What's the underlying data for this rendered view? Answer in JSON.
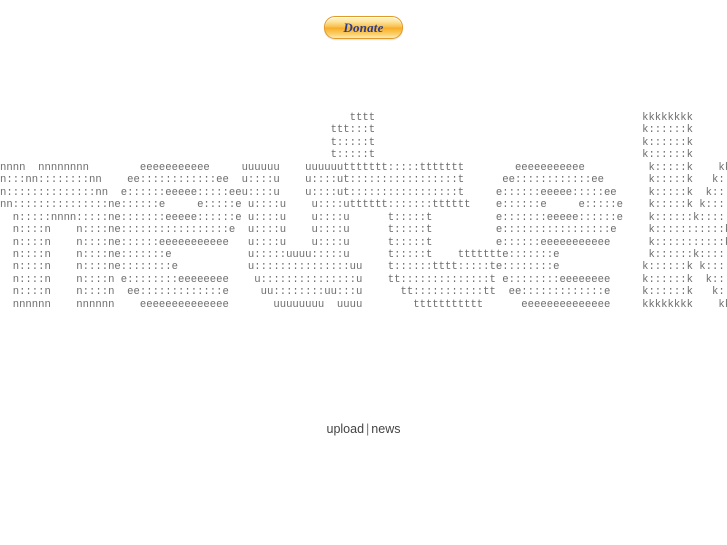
{
  "page": {
    "background_color": "#ffffff",
    "text_color": "#444444",
    "ascii_color": "#6e6e6e"
  },
  "donate": {
    "label": "Donate",
    "text_color": "#2a3c8f",
    "border_color": "#e09a2a",
    "gradient_top": "#fff4d2",
    "gradient_mid": "#f7ad25",
    "gradient_bottom": "#fde9b6"
  },
  "banner": {
    "word": "nneutek",
    "font_style": "figlet-ascii-art",
    "char_set": "nneutk:",
    "ascii": "                                                       tttt                                          kkkkkkkk\n                                                    ttt:::t                                          k::::::k\n                                                    t:::::t                                          k::::::k\n                                                    t:::::t                                          k::::::k\nnnnn  nnnnnnnn        eeeeeeeeeee     uuuuuu    uuuuuuttttttt:::::ttttttt        eeeeeeeeeee          k:::::k    kkkkkkk\nn:::nn::::::::nn    ee::::::::::::ee  u::::u    u::::ut:::::::::::::::::t      ee::::::::::::ee       k:::::k   k:::::k\nn::::::::::::::nn  e::::::eeeee:::::eeu::::u    u::::ut:::::::::::::::::t     e::::::eeeee:::::ee     k:::::k  k:::::k\nnn:::::::::::::::ne::::::e     e:::::e u::::u    u::::utttttt:::::::tttttt    e::::::e     e:::::e    k:::::k k:::::k\n  n:::::nnnn:::::ne:::::::eeeee::::::e u::::u    u::::u      t:::::t          e:::::::eeeee::::::e    k::::::k:::::k\n  n::::n    n::::ne:::::::::::::::::e  u::::u    u::::u      t:::::t          e:::::::::::::::::e     k:::::::::::k\n  n::::n    n::::ne::::::eeeeeeeeeee   u::::u    u::::u      t:::::t          e::::::eeeeeeeeeee      k:::::::::::k\n  n::::n    n::::ne:::::::e            u:::::uuuu:::::u      t:::::t    ttttttte:::::::e              k::::::k:::::k\n  n::::n    n::::ne::::::::e           u:::::::::::::::uu    t::::::tttt:::::te::::::::e             k::::::k k:::::k\n  n::::n    n::::n e::::::::eeeeeeee    u:::::::::::::::u    tt::::::::::::::t e::::::::eeeeeeee     k::::::k  k:::::k\n  n::::n    n::::n  ee:::::::::::::e     uu::::::::uu:::u      tt:::::::::::tt  ee:::::::::::::e     k::::::k   k:::::k\n  nnnnnn    nnnnnn    eeeeeeeeeeeeee       uuuuuuuu  uuuu        ttttttttttt      eeeeeeeeeeeeee     kkkkkkkk    kkkkkkk",
    "lines": [
      "                                                       tttt                                          kkkkkkkk",
      "                                                    ttt:::t                                          k::::::k",
      "                                                    t:::::t                                          k::::::k",
      "                                                    t:::::t                                          k::::::k",
      "nnnn  nnnnnnnn        eeeeeeeeeee     uuuuuu    uuuuuuttttttt:::::ttttttt        eeeeeeeeeee          k:::::k    kkkkkkk",
      "n:::nn::::::::nn    ee::::::::::::ee  u::::u    u::::ut:::::::::::::::::t      ee::::::::::::ee       k:::::k   k:::::k",
      "n::::::::::::::nn  e::::::eeeee:::::eeu::::u    u::::ut:::::::::::::::::t     e::::::eeeee:::::ee     k:::::k  k:::::k",
      "nn:::::::::::::::ne::::::e     e:::::e u::::u    u::::utttttt:::::::tttttt    e::::::e     e:::::e    k:::::k k:::::k",
      "  n:::::nnnn:::::ne:::::::eeeee::::::e u::::u    u::::u      t:::::t          e:::::::eeeee::::::e    k::::::k:::::k",
      "  n::::n    n::::ne:::::::::::::::::e  u::::u    u::::u      t:::::t          e:::::::::::::::::e     k:::::::::::k",
      "  n::::n    n::::ne::::::eeeeeeeeeee   u::::u    u::::u      t:::::t          e::::::eeeeeeeeeee      k:::::::::::k",
      "  n::::n    n::::ne:::::::e            u:::::uuuu:::::u      t:::::t    ttttttte:::::::e              k::::::k:::::k",
      "  n::::n    n::::ne::::::::e           u:::::::::::::::uu    t::::::tttt:::::te::::::::e             k::::::k k:::::k",
      "  n::::n    n::::n e::::::::eeeeeeee    u:::::::::::::::u    tt::::::::::::::t e::::::::eeeeeeee     k::::::k  k:::::k",
      "  n::::n    n::::n  ee:::::::::::::e     uu::::::::uu:::u      tt:::::::::::tt  ee:::::::::::::e     k::::::k   k:::::k",
      "  nnnnnn    nnnnnn    eeeeeeeeeeeeee       uuuuuuuu  uuuu        ttttttttttt      eeeeeeeeeeeeee     kkkkkkkk    kkkkkkk"
    ]
  },
  "footer": {
    "upload_label": "upload",
    "separator": "|",
    "news_label": "news"
  }
}
